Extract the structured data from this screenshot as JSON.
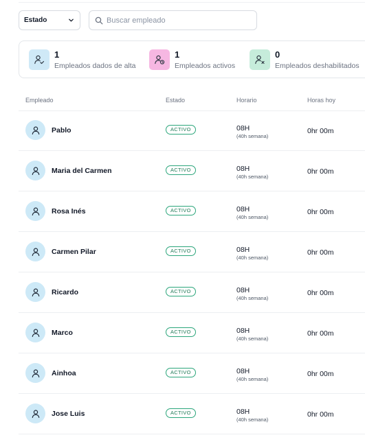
{
  "filters": {
    "status_select_value": "Estado",
    "search_placeholder": "Buscar empleado"
  },
  "stats": [
    {
      "value": "1",
      "label": "Empleados dados de alta",
      "icon": "user-check-icon",
      "color": "#cfe9f7"
    },
    {
      "value": "1",
      "label": "Empleados activos",
      "icon": "user-clock-icon",
      "color": "#f6b7e2"
    },
    {
      "value": "0",
      "label": "Empleados deshabilitados",
      "icon": "user-x-icon",
      "color": "#c6ecdb"
    }
  ],
  "table": {
    "headers": {
      "employee": "Empleado",
      "status": "Estado",
      "schedule": "Horario",
      "hours_today": "Horas hoy"
    },
    "rows": [
      {
        "name": "Pablo",
        "status": "ACTIVO",
        "hours": "08H",
        "week": "(40h semana)",
        "today": "0hr 00m"
      },
      {
        "name": "Maria del Carmen",
        "status": "ACTIVO",
        "hours": "08H",
        "week": "(40h semana)",
        "today": "0hr 00m"
      },
      {
        "name": "Rosa Inés",
        "status": "ACTIVO",
        "hours": "08H",
        "week": "(40h semana)",
        "today": "0hr 00m"
      },
      {
        "name": "Carmen Pilar",
        "status": "ACTIVO",
        "hours": "08H",
        "week": "(40h semana)",
        "today": "0hr 00m"
      },
      {
        "name": "Ricardo",
        "status": "ACTIVO",
        "hours": "08H",
        "week": "(40h semana)",
        "today": "0hr 00m"
      },
      {
        "name": "Marco",
        "status": "ACTIVO",
        "hours": "08H",
        "week": "(40h semana)",
        "today": "0hr 00m"
      },
      {
        "name": "Ainhoa",
        "status": "ACTIVO",
        "hours": "08H",
        "week": "(40h semana)",
        "today": "0hr 00m"
      },
      {
        "name": "Jose Luis",
        "status": "ACTIVO",
        "hours": "08H",
        "week": "(40h semana)",
        "today": "0hr 00m"
      }
    ]
  },
  "colors": {
    "accent_green": "#2aa57a",
    "avatar_bg": "#cde9f7"
  }
}
